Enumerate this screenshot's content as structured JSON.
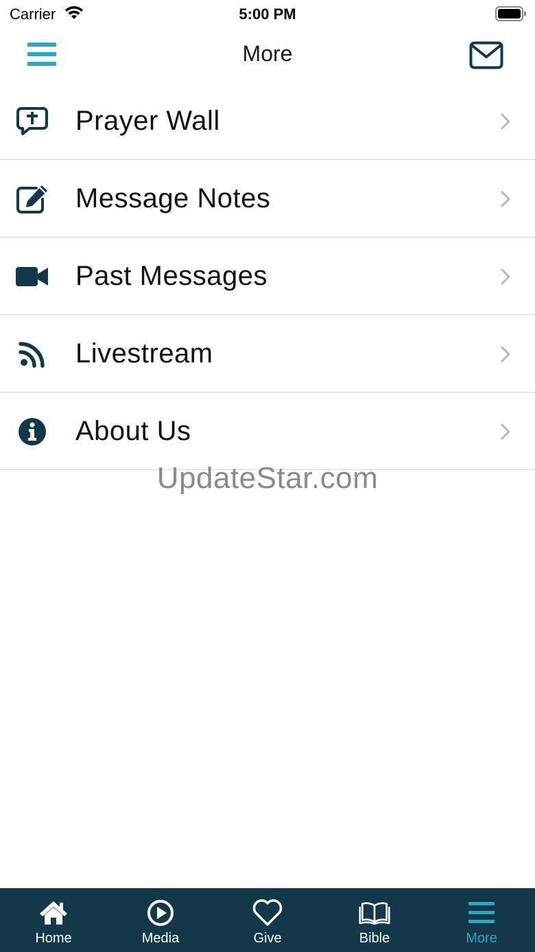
{
  "status_bar": {
    "carrier": "Carrier",
    "time": "5:00 PM"
  },
  "nav": {
    "title": "More",
    "menu_icon": "hamburger-menu-icon",
    "mail_icon": "envelope-icon"
  },
  "menu_items": [
    {
      "label": "Prayer Wall",
      "icon": "prayer-speech-bubble-icon"
    },
    {
      "label": "Message Notes",
      "icon": "edit-note-icon"
    },
    {
      "label": "Past Messages",
      "icon": "video-camera-icon"
    },
    {
      "label": "Livestream",
      "icon": "rss-feed-icon"
    },
    {
      "label": "About Us",
      "icon": "info-icon"
    }
  ],
  "watermark": "UpdateStar.com",
  "tabs": [
    {
      "label": "Home",
      "icon": "home-icon",
      "active": false
    },
    {
      "label": "Media",
      "icon": "play-circle-icon",
      "active": false
    },
    {
      "label": "Give",
      "icon": "heart-icon",
      "active": false
    },
    {
      "label": "Bible",
      "icon": "open-book-icon",
      "active": false
    },
    {
      "label": "More",
      "icon": "hamburger-menu-icon",
      "active": true
    }
  ],
  "colors": {
    "accent": "#31a6c2",
    "dark_teal": "#12384a",
    "separator": "#d6d6d6",
    "chevron": "#b8b8b8"
  }
}
